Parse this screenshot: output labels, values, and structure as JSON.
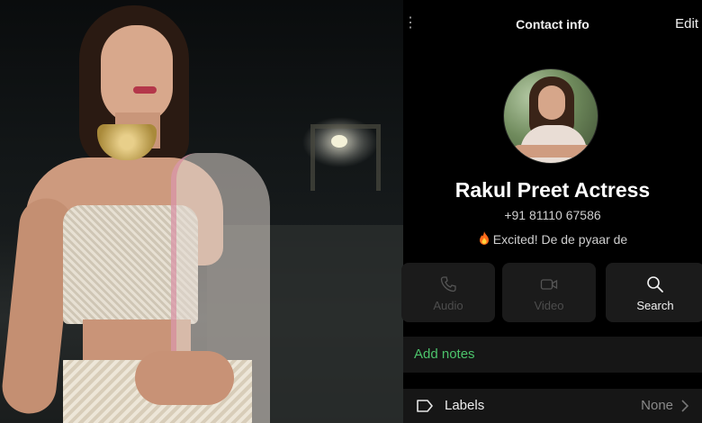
{
  "header": {
    "title": "Contact info",
    "edit_label": "Edit"
  },
  "contact": {
    "name": "Rakul Preet Actress",
    "phone": "+91 81110 67586",
    "status_emoji_icon": "fire-icon",
    "status_text": "Excited! De de pyaar de"
  },
  "actions": [
    {
      "label": "Audio",
      "icon": "phone-icon",
      "enabled": false
    },
    {
      "label": "Video",
      "icon": "video-icon",
      "enabled": false
    },
    {
      "label": "Search",
      "icon": "search-icon",
      "enabled": true
    }
  ],
  "notes": {
    "label": "Add notes",
    "color": "#4cc36b"
  },
  "labels_row": {
    "label": "Labels",
    "value": "None",
    "icon": "tag-icon"
  },
  "colors": {
    "background": "#000000",
    "card": "#1b1b1b",
    "accent_green": "#4cc36b"
  }
}
